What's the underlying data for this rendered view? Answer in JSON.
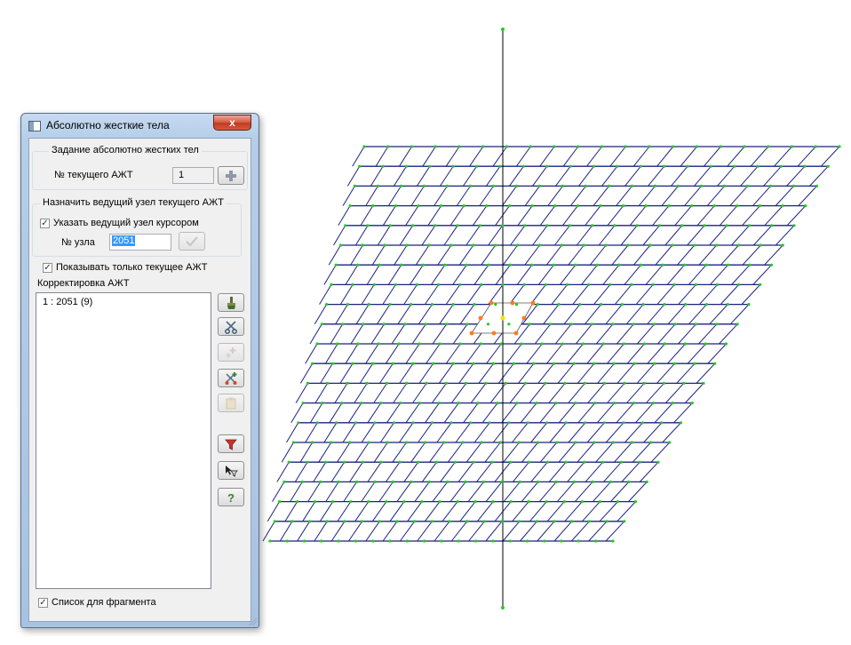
{
  "window": {
    "title": "Абсолютно жесткие тела",
    "close_glyph": "x"
  },
  "group_define": {
    "label": "Задание абсолютно жестких тел",
    "current_label": "№ текущего АЖТ",
    "current_value": "1",
    "add_icon": "plus-icon"
  },
  "group_master": {
    "label": "Назначить ведущий узел текущего АЖТ",
    "cursor_checkbox_label": "Указать ведущий узел курсором",
    "cursor_checked": true,
    "node_label": "№ узла",
    "node_value": "2051",
    "apply_icon": "checkmark-icon"
  },
  "show_current_only": {
    "label": "Показывать только текущее АЖТ",
    "checked": true
  },
  "correction": {
    "label": "Корректировка АЖТ",
    "items": [
      "1 : 2051 (9)"
    ]
  },
  "side_tools": [
    {
      "name": "brush-button",
      "icon": "brush-icon",
      "enabled": true
    },
    {
      "name": "scissors-button",
      "icon": "scissors-icon",
      "enabled": true
    },
    {
      "name": "add-nodes-button",
      "icon": "plus-sparkle-icon",
      "enabled": false
    },
    {
      "name": "cut-nodes-button",
      "icon": "scissors-plus-icon",
      "enabled": false
    },
    {
      "name": "paste-button",
      "icon": "clipboard-icon",
      "enabled": false
    },
    {
      "name": "filter-button",
      "icon": "filter-icon",
      "enabled": true
    },
    {
      "name": "select-filter-button",
      "icon": "cursor-filter-icon",
      "enabled": true
    },
    {
      "name": "help-button",
      "icon": "help-icon",
      "enabled": true
    }
  ],
  "fragment_list": {
    "label": "Список для фрагмента",
    "checked": true
  },
  "colors": {
    "mesh_line": "#1c2280",
    "mesh_node": "#22cc22",
    "rigid_node": "#ff7a1a",
    "master_node": "#f2e400",
    "axis": "#000000"
  }
}
